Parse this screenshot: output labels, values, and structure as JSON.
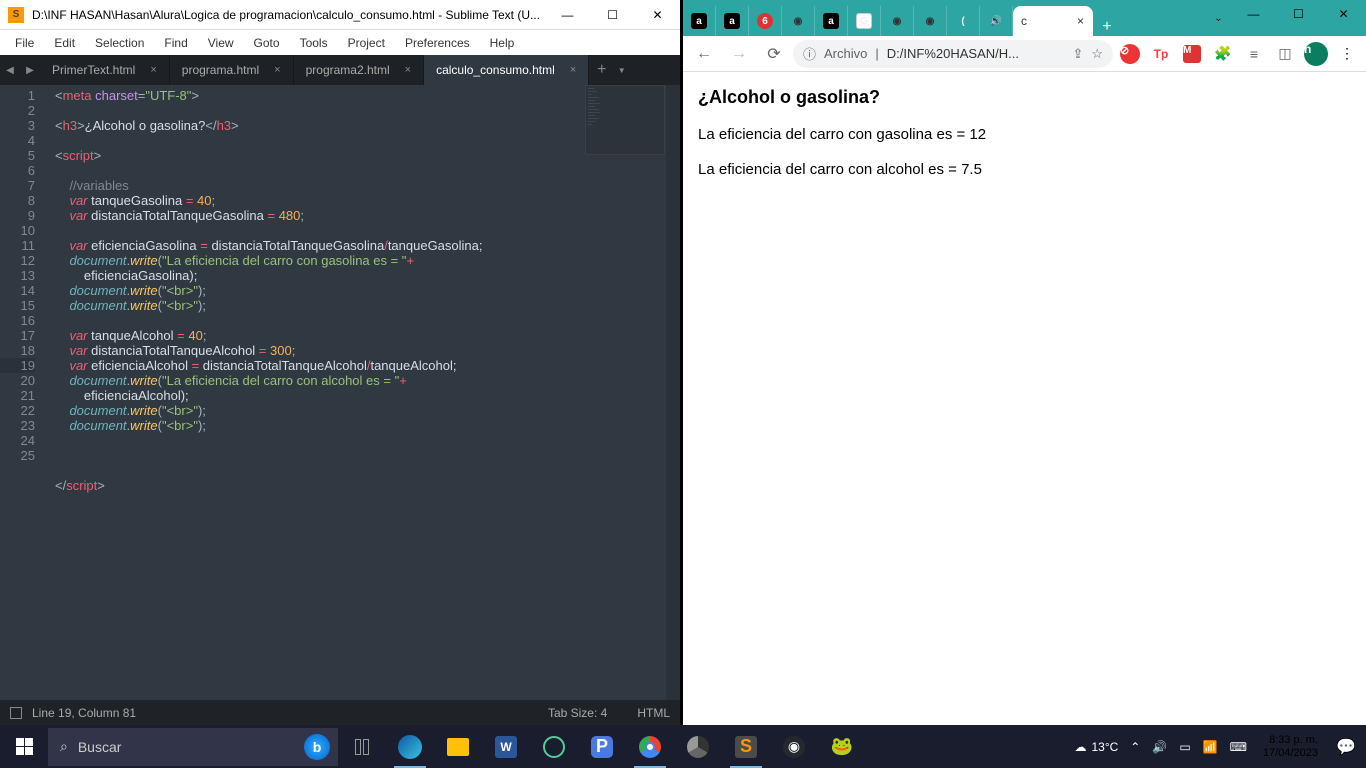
{
  "sublime": {
    "title": "D:\\INF HASAN\\Hasan\\Alura\\Logica de programacion\\calculo_consumo.html - Sublime Text (U...",
    "menu": [
      "File",
      "Edit",
      "Selection",
      "Find",
      "View",
      "Goto",
      "Tools",
      "Project",
      "Preferences",
      "Help"
    ],
    "tabs": [
      {
        "label": "PrimerText.html",
        "active": false
      },
      {
        "label": "programa.html",
        "active": false
      },
      {
        "label": "programa2.html",
        "active": false
      },
      {
        "label": "calculo_consumo.html",
        "active": true
      }
    ],
    "lines": [
      "1",
      "2",
      "3",
      "4",
      "5",
      "6",
      "7",
      "8",
      "9",
      "10",
      "11",
      "12",
      "",
      "13",
      "14",
      "15",
      "16",
      "17",
      "18",
      "19",
      "",
      "20",
      "21",
      "22",
      "23",
      "24",
      "25"
    ],
    "active_line": "19",
    "status": {
      "cursor": "Line 19, Column 81",
      "tab": "Tab Size: 4",
      "lang": "HTML"
    }
  },
  "chrome": {
    "tabs_favicons": [
      "a",
      "a",
      "6",
      "◉",
      "a",
      "G",
      "◉",
      "◉",
      "(",
      "🔊"
    ],
    "active_tab": {
      "prefix": "c",
      "close": "×"
    },
    "toolbar": {
      "info_icon": "ⓘ",
      "proto": "Archivo",
      "path": "D:/INF%20HASAN/H...",
      "star": "☆"
    },
    "page": {
      "heading": "¿Alcohol o gasolina?",
      "line1": "La eficiencia del carro con gasolina es = 12",
      "line2": "La eficiencia del carro con alcohol es = 7.5"
    }
  },
  "taskbar": {
    "search_placeholder": "Buscar",
    "weather": "13°C",
    "time": "8:33 p. m.",
    "date": "17/04/2023"
  },
  "code": {
    "l1": {
      "a": "<",
      "b": "meta ",
      "c": "charset",
      "d": "=",
      "e": "\"UTF-8\"",
      "f": ">"
    },
    "l3": {
      "a": "<",
      "b": "h3",
      "c": ">",
      "d": "¿Alcohol o gasolina?",
      "e": "</",
      "f": "h3",
      "g": ">"
    },
    "l5": {
      "a": "<",
      "b": "script",
      "c": ">"
    },
    "l7": "    //variables",
    "l8": {
      "a": "    ",
      "b": "var",
      "c": " tanqueGasolina ",
      "d": "=",
      "e": " ",
      "f": "40",
      "g": ";"
    },
    "l9": {
      "a": "    ",
      "b": "var",
      "c": " distanciaTotalTanqueGasolina ",
      "d": "=",
      "e": " ",
      "f": "480",
      "g": ";"
    },
    "l11": {
      "a": "    ",
      "b": "var",
      "c": " eficienciaGasolina ",
      "d": "=",
      "e": " distanciaTotalTanqueGasolina",
      "f": "/",
      "g": "tanqueGasolina;"
    },
    "l12": {
      "a": "    ",
      "b": "document",
      "c": ".",
      "d": "write",
      "e": "(",
      "f": "\"La eficiencia del carro con gasolina es = \"",
      "g": "+"
    },
    "l12b": "        eficienciaGasolina);",
    "l13": {
      "a": "    ",
      "b": "document",
      "c": ".",
      "d": "write",
      "e": "(",
      "f": "\"<br>\"",
      "g": ");"
    },
    "l14": {
      "a": "    ",
      "b": "document",
      "c": ".",
      "d": "write",
      "e": "(",
      "f": "\"<br>\"",
      "g": ");"
    },
    "l16": {
      "a": "    ",
      "b": "var",
      "c": " tanqueAlcohol ",
      "d": "=",
      "e": " ",
      "f": "40",
      "g": ";"
    },
    "l17": {
      "a": "    ",
      "b": "var",
      "c": " distanciaTotalTanqueAlcohol ",
      "d": "=",
      "e": " ",
      "f": "300",
      "g": ";"
    },
    "l18": {
      "a": "    ",
      "b": "var",
      "c": " eficienciaAlcohol ",
      "d": "=",
      "e": " distanciaTotalTanqueAlcohol",
      "f": "/",
      "g": "tanqueAlcohol;"
    },
    "l19": {
      "a": "    ",
      "b": "document",
      "c": ".",
      "d": "write",
      "e": "(",
      "f": "\"La eficiencia del carro con alcohol es = \"",
      "g": "+"
    },
    "l19b": "        eficienciaAlcohol);",
    "l20": {
      "a": "    ",
      "b": "document",
      "c": ".",
      "d": "write",
      "e": "(",
      "f": "\"<br>\"",
      "g": ");"
    },
    "l21": {
      "a": "    ",
      "b": "document",
      "c": ".",
      "d": "write",
      "e": "(",
      "f": "\"<br>\"",
      "g": ");"
    },
    "l25": {
      "a": "</",
      "b": "script",
      "c": ">"
    }
  }
}
